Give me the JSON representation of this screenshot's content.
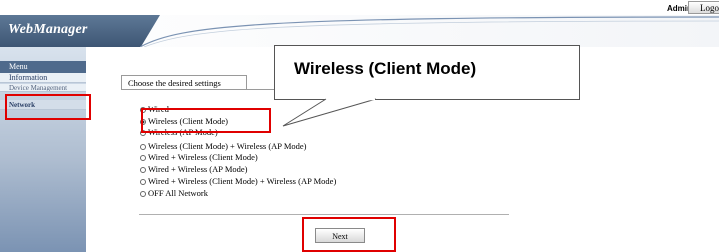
{
  "header": {
    "logo": "WebManager",
    "admin_label": "Admin",
    "logout_label": "Logout"
  },
  "sidebar": {
    "menu_title": "Menu",
    "items": [
      {
        "label": "Information"
      },
      {
        "label": "Device Management"
      },
      {
        "label": "Network"
      }
    ]
  },
  "main": {
    "tab_label": "Choose the desired settings",
    "options": [
      {
        "label": "Wired",
        "selected": false
      },
      {
        "label": "Wireless (Client Mode)",
        "selected": true
      },
      {
        "label": "Wireless (AP Mode)",
        "selected": false
      },
      {
        "label": "Wireless (Client Mode) + Wireless (AP Mode)",
        "selected": false
      },
      {
        "label": "Wired + Wireless (Client Mode)",
        "selected": false
      },
      {
        "label": "Wired + Wireless (AP Mode)",
        "selected": false
      },
      {
        "label": "Wired + Wireless (Client Mode) + Wireless (AP Mode)",
        "selected": false
      },
      {
        "label": "OFF All Network",
        "selected": false
      }
    ],
    "next_label": "Next"
  },
  "callout": {
    "text": "Wireless (Client Mode)"
  },
  "colors": {
    "highlight": "#e00000",
    "header_dark": "#4a6382",
    "menu_title_bg": "#4f6a8c"
  }
}
